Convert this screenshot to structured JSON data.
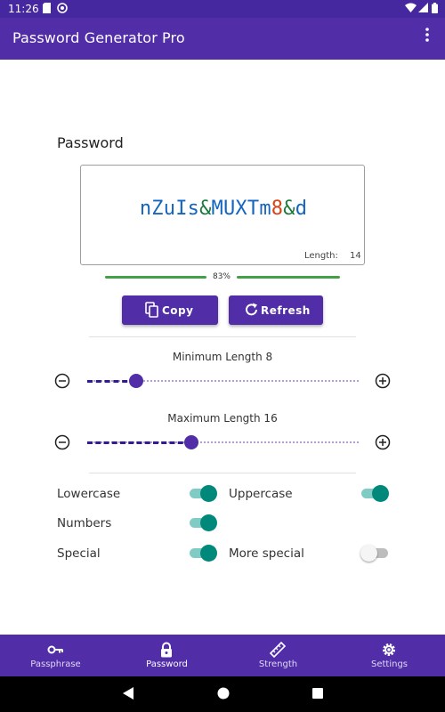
{
  "status_bar": {
    "time": "11:26"
  },
  "app_bar": {
    "title": "Password Generator Pro",
    "menu_icon": "more-vert-icon"
  },
  "password_section": {
    "title": "Password",
    "password": "nZuIs&MUXTm8&d",
    "password_parts": [
      {
        "text": "nZuIs",
        "kind": "letter"
      },
      {
        "text": "&",
        "kind": "special"
      },
      {
        "text": "MUXTm",
        "kind": "letter"
      },
      {
        "text": "8",
        "kind": "number"
      },
      {
        "text": "&",
        "kind": "special"
      },
      {
        "text": "d",
        "kind": "letter"
      }
    ],
    "length_label": "Length:",
    "length_value": "14",
    "strength_percent": "83%",
    "strength_value": 0.83,
    "colors": {
      "letter": "#1565c0",
      "special": "#1b7a3a",
      "number": "#d84315",
      "strength": "#43a047"
    }
  },
  "actions": {
    "copy_label": "Copy",
    "refresh_label": "Refresh"
  },
  "sliders": {
    "min": {
      "label": "Minimum Length 8",
      "value": 8
    },
    "max": {
      "label": "Maximum Length 16",
      "value": 16
    }
  },
  "options": {
    "lowercase": {
      "label": "Lowercase",
      "on": true
    },
    "uppercase": {
      "label": "Uppercase",
      "on": true
    },
    "numbers": {
      "label": "Numbers",
      "on": true
    },
    "special": {
      "label": "Special",
      "on": true
    },
    "more_special": {
      "label": "More special",
      "on": false
    }
  },
  "bottom_nav": {
    "items": [
      {
        "label": "Passphrase",
        "icon": "key-icon",
        "active": false
      },
      {
        "label": "Password",
        "icon": "lock-icon",
        "active": true
      },
      {
        "label": "Strength",
        "icon": "ruler-icon",
        "active": false
      },
      {
        "label": "Settings",
        "icon": "gear-icon",
        "active": false
      }
    ]
  },
  "theme": {
    "primary": "#512da8",
    "status_bar": "#4527a0",
    "switch_on": "#00897b"
  }
}
